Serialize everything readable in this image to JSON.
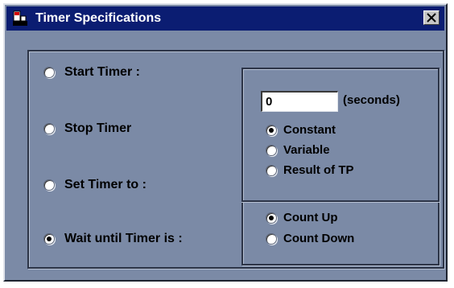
{
  "window": {
    "title": "Timer Specifications",
    "title_bar_color": "#0b1d72",
    "background_color": "#7b8aa6",
    "icons": {
      "app": "timer-app-icon",
      "close": "close-icon"
    }
  },
  "timer_actions": [
    {
      "label": "Start Timer :",
      "checked": false
    },
    {
      "label": "Stop Timer",
      "checked": false
    },
    {
      "label": "Set Timer to :",
      "checked": false
    },
    {
      "label": "Wait until Timer is :",
      "checked": true
    }
  ],
  "duration": {
    "value": "0",
    "unit_label": "(seconds)",
    "options": [
      {
        "label": "Constant",
        "checked": true
      },
      {
        "label": "Variable",
        "checked": false
      },
      {
        "label": "Result of TP",
        "checked": false
      }
    ]
  },
  "count_direction": {
    "options": [
      {
        "label": "Count Up",
        "checked": true
      },
      {
        "label": "Count Down",
        "checked": false
      }
    ]
  }
}
